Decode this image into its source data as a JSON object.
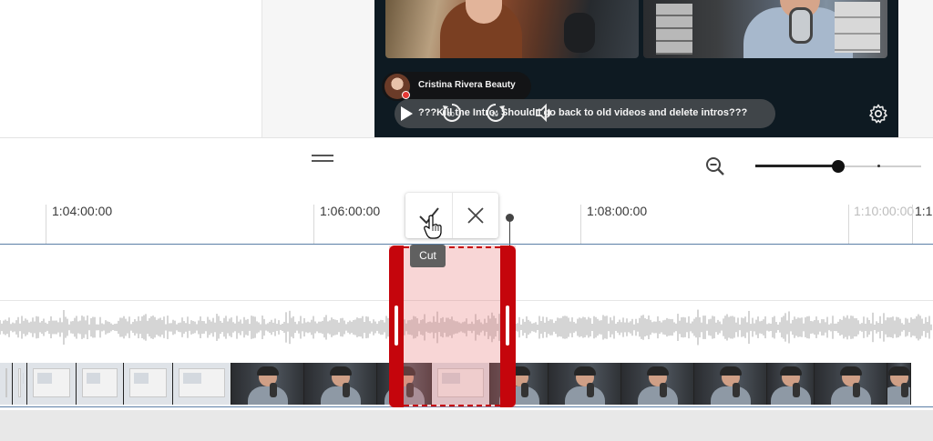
{
  "preview": {
    "channel_name": "Cristina Rivera Beauty",
    "video_title": "???Kill the Intro: Should I go back to old videos and delete intros???"
  },
  "timeline": {
    "ticks": [
      {
        "label": "1:04:00:00"
      },
      {
        "label": "1:06:00:00"
      },
      {
        "label": "1:08:00:00"
      },
      {
        "label": "1:10:00:00",
        "faded": true
      },
      {
        "label": "1:1"
      }
    ],
    "zoom_level_fraction": 0.5
  },
  "cut_popup": {
    "tooltip": "Cut"
  },
  "colors": {
    "selection_red": "#c5050c",
    "selection_fill": "#f3c4c4",
    "track_accent": "#5b7fa6"
  },
  "icons": [
    "play-icon",
    "rewind-10-icon",
    "forward-10-icon",
    "volume-icon",
    "settings-icon",
    "drag-handle-icon",
    "zoom-out-icon",
    "check-icon",
    "close-icon",
    "hand-cursor-icon"
  ]
}
